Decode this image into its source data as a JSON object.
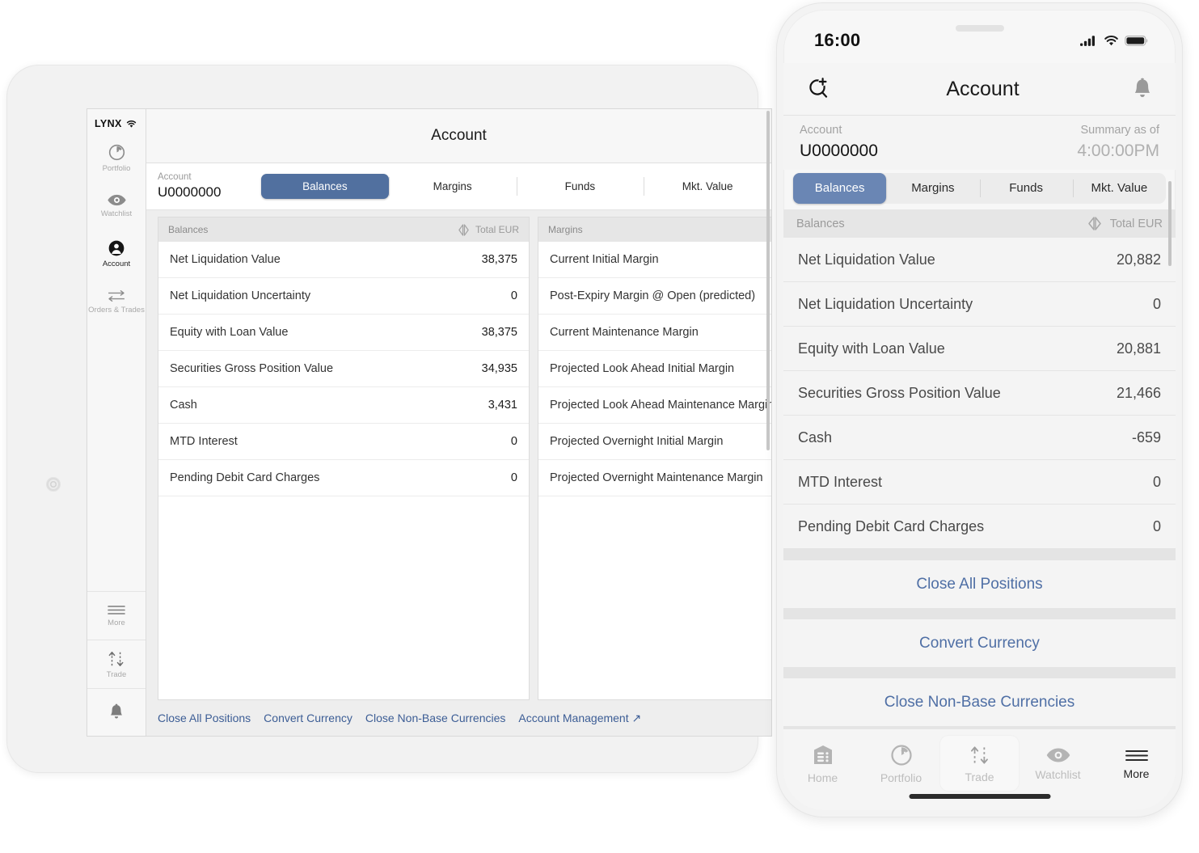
{
  "tablet": {
    "brand": "LYNX",
    "rail": {
      "top_items": [
        {
          "label": "Portfolio",
          "icon": "portfolio-icon",
          "active": false
        },
        {
          "label": "Watchlist",
          "icon": "eye-icon",
          "active": false
        },
        {
          "label": "Account",
          "icon": "person-icon",
          "active": true
        },
        {
          "label": "Orders & Trades",
          "icon": "arrows-icon",
          "active": false
        }
      ],
      "bottom_items": [
        {
          "label": "More",
          "icon": "hamburger-icon",
          "active": false
        },
        {
          "label": "Trade",
          "icon": "trade-arrows-icon",
          "active": false
        },
        {
          "label": "",
          "icon": "bell-icon",
          "active": false
        }
      ]
    },
    "title": "Account",
    "account_label": "Account",
    "account_value": "U0000000",
    "tabs": [
      {
        "label": "Balances",
        "active": true
      },
      {
        "label": "Margins",
        "active": false
      },
      {
        "label": "Funds",
        "active": false
      },
      {
        "label": "Mkt. Value",
        "active": false
      }
    ],
    "balances_panel": {
      "title": "Balances",
      "currency": "Total EUR",
      "rows": [
        {
          "label": "Net Liquidation Value",
          "value": "38,375"
        },
        {
          "label": "Net Liquidation Uncertainty",
          "value": "0"
        },
        {
          "label": "Equity with Loan Value",
          "value": "38,375"
        },
        {
          "label": "Securities Gross Position Value",
          "value": "34,935"
        },
        {
          "label": "Cash",
          "value": "3,431"
        },
        {
          "label": "MTD Interest",
          "value": "0"
        },
        {
          "label": "Pending Debit Card Charges",
          "value": "0"
        }
      ]
    },
    "margins_panel": {
      "title": "Margins",
      "rows": [
        {
          "label": "Current Initial Margin",
          "value": ""
        },
        {
          "label": "Post-Expiry Margin @ Open (predicted)",
          "value": ""
        },
        {
          "label": "Current Maintenance Margin",
          "value": ""
        },
        {
          "label": "Projected Look Ahead Initial Margin",
          "value": ""
        },
        {
          "label": "Projected Look Ahead Maintenance Margin",
          "value": ""
        },
        {
          "label": "Projected Overnight Initial Margin",
          "value": ""
        },
        {
          "label": "Projected Overnight Maintenance Margin",
          "value": ""
        }
      ]
    },
    "footer_links": [
      "Close All Positions",
      "Convert Currency",
      "Close Non-Base Currencies",
      "Account Management ↗"
    ]
  },
  "phone": {
    "status": {
      "time": "16:00",
      "signal_icon": "cellular-signal-icon",
      "wifi_icon": "wifi-icon",
      "battery_icon": "battery-icon"
    },
    "navbar": {
      "left_icon": "add-search-icon",
      "title": "Account",
      "right_icon": "bell-icon"
    },
    "account_label": "Account",
    "account_value": "U0000000",
    "summary_label": "Summary as of",
    "summary_time": "4:00:00PM",
    "tabs": [
      {
        "label": "Balances",
        "active": true
      },
      {
        "label": "Margins",
        "active": false
      },
      {
        "label": "Funds",
        "active": false
      },
      {
        "label": "Mkt. Value",
        "active": false
      }
    ],
    "subhead": {
      "title": "Balances",
      "currency": "Total EUR",
      "currency_icon": "currency-toggle-icon"
    },
    "rows": [
      {
        "label": "Net Liquidation Value",
        "value": "20,882"
      },
      {
        "label": "Net Liquidation Uncertainty",
        "value": "0"
      },
      {
        "label": "Equity with Loan Value",
        "value": "20,881"
      },
      {
        "label": "Securities Gross Position Value",
        "value": "21,466"
      },
      {
        "label": "Cash",
        "value": "-659"
      },
      {
        "label": "MTD Interest",
        "value": "0"
      },
      {
        "label": "Pending Debit Card Charges",
        "value": "0"
      }
    ],
    "actions": [
      "Close All Positions",
      "Convert Currency",
      "Close Non-Base Currencies"
    ],
    "tabbar": [
      {
        "label": "Home",
        "icon": "home-icon",
        "active": false,
        "highlight": false
      },
      {
        "label": "Portfolio",
        "icon": "portfolio-icon",
        "active": false,
        "highlight": false
      },
      {
        "label": "Trade",
        "icon": "trade-arrows-icon",
        "active": false,
        "highlight": true
      },
      {
        "label": "Watchlist",
        "icon": "eye-icon",
        "active": false,
        "highlight": false
      },
      {
        "label": "More",
        "icon": "hamburger-icon",
        "active": true,
        "highlight": false
      }
    ]
  },
  "colors": {
    "accent_blue": "#51709f",
    "phone_accent_blue": "#6a86b4",
    "link_blue": "#3c5d95"
  }
}
